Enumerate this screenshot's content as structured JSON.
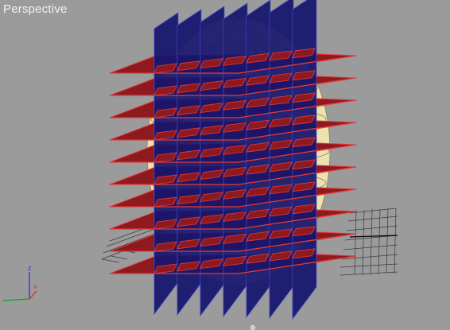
{
  "viewport": {
    "label": "Perspective",
    "background": "#9b9b9b"
  },
  "colors": {
    "horizontal_plane": "#8e1a1f",
    "horizontal_plane_edge": "#e23a3a",
    "vertical_plane": "#16166e",
    "vertical_plane_edge": "#4848c0",
    "object_mesh": "#efe2b0",
    "home_grid": "#3a3a3a"
  },
  "gizmo": {
    "z_label": "z",
    "x_label": "x",
    "z_color": "#3a3ad0",
    "x_color": "#d03a3a",
    "y_color": "#2aa02a"
  },
  "icons": {
    "viewcube": "viewcube-icon"
  }
}
